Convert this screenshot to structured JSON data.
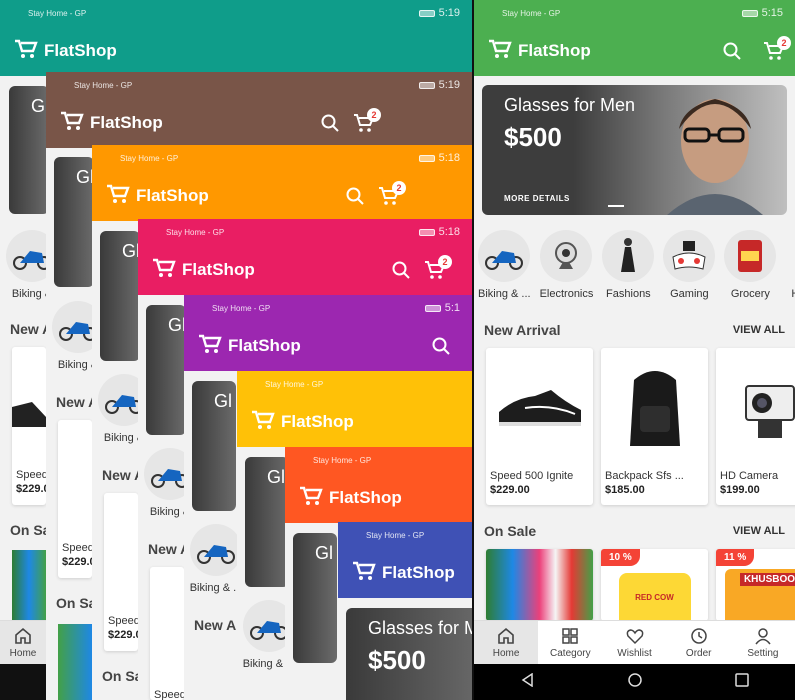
{
  "app_name": "FlatShop",
  "status": {
    "carrier": "Stay Home - GP",
    "time_left": "5:19",
    "time_right": "5:15",
    "times": [
      "5:19",
      "5:18",
      "5:18",
      "5:1",
      "",
      ""
    ]
  },
  "cart_count": "2",
  "banner": {
    "title": "Glasses for Men",
    "price": "$500",
    "more": "MORE DETAILS"
  },
  "categories": [
    "Biking & ...",
    "Electronics",
    "Fashions",
    "Gaming",
    "Grocery",
    "H"
  ],
  "sections": {
    "new_arrival": "New Arrival",
    "on_sale": "On Sale",
    "view_all": "VIEW ALL"
  },
  "products": [
    {
      "name": "Speed 500 Ignite",
      "price": "$229.00"
    },
    {
      "name": "Backpack Sfs ...",
      "price": "$185.00"
    },
    {
      "name": "HD Camera",
      "price": "$199.00"
    }
  ],
  "sale": [
    {
      "discount": "10 %",
      "label": "RED COW"
    },
    {
      "discount": "11 %",
      "label": "KHUSBOO"
    }
  ],
  "nav": [
    "Home",
    "Category",
    "Wishlist",
    "Order",
    "Setting"
  ],
  "cascade": {
    "banner_partials": [
      "Gl",
      "$",
      "MORE"
    ],
    "biking": "Biking &",
    "biking_long": "Biking & ...",
    "new_partial": "New A",
    "on_partial": "On Sa",
    "speed_partial": "Speed",
    "price_partial": "$229.0",
    "last_banner_title": "Glasses for Me"
  },
  "colors": {
    "teal": "#0f9d8a",
    "brown": "#795548",
    "orange": "#ff9800",
    "pink": "#e91e63",
    "purple": "#9c27b0",
    "amber": "#ffc107",
    "deep_orange": "#ff5722",
    "indigo": "#3f51b5",
    "green": "#4caf50"
  }
}
